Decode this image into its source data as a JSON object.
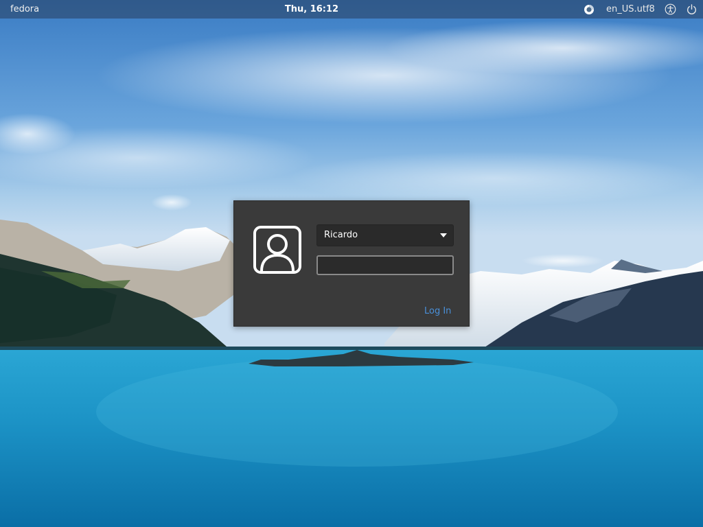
{
  "top_panel": {
    "host": "fedora",
    "clock": "Thu, 16:12",
    "language": "en_US.utf8",
    "icons": {
      "status": "session-ring-icon",
      "accessibility": "accessibility-icon",
      "power": "power-icon"
    }
  },
  "login": {
    "avatar_icon": "user-avatar-icon",
    "username": "Ricardo",
    "password_value": "",
    "login_label": "Log In"
  },
  "colors": {
    "dialog_bg": "#3a3a3a",
    "accent_link": "#4a90d9",
    "panel_bg": "#283e5c"
  }
}
